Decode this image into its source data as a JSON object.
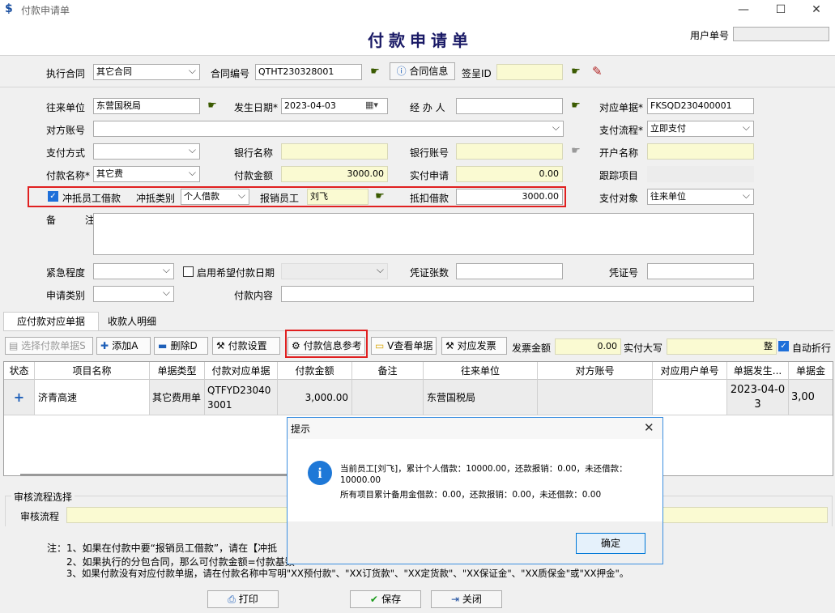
{
  "window": {
    "title": "付款申请单",
    "form_title": "付款申请单",
    "user_no_label": "用户单号",
    "user_no_value": ""
  },
  "row1": {
    "contract_label": "执行合同",
    "contract_value": "其它合同",
    "contract_no_label": "合同编号",
    "contract_no_value": "QTHT230328001",
    "contract_info_btn": "合同信息",
    "sign_id_label": "签呈ID",
    "sign_id_value": ""
  },
  "row2": {
    "unit_label": "往来单位",
    "unit_value": "东营国税局",
    "date_label": "发生日期*",
    "date_value": "2023-04-03",
    "handler_label": "经 办 人",
    "handler_value": "",
    "doc_label": "对应单据*",
    "doc_value": "FKSQD230400001"
  },
  "row3": {
    "account_label": "对方账号",
    "account_value": "",
    "flow_label": "支付流程*",
    "flow_value": "立即支付"
  },
  "row4": {
    "paymethod_label": "支付方式",
    "paymethod_value": "",
    "bankname_label": "银行名称",
    "bankname_value": "",
    "bankacct_label": "银行账号",
    "bankacct_value": "",
    "acctname_label": "开户名称",
    "acctname_value": ""
  },
  "row5": {
    "payname_label": "付款名称*",
    "payname_value": "其它费",
    "amount_label": "付款金额",
    "amount_value": "3000.00",
    "actual_label": "实付申请",
    "actual_value": "0.00",
    "track_label": "跟踪项目",
    "track_value": ""
  },
  "row6": {
    "offset_check_label": "冲抵员工借款",
    "offset_type_label": "冲抵类别",
    "offset_type_value": "个人借款",
    "employee_label": "报销员工",
    "employee_value": "刘飞",
    "deduct_label": "抵扣借款",
    "deduct_value": "3000.00",
    "target_label": "支付对象",
    "target_value": "往来单位"
  },
  "remark": {
    "label": "备　注",
    "value": ""
  },
  "row8": {
    "urgency_label": "紧急程度",
    "urgency_value": "",
    "hope_date_label": "启用希望付款日期",
    "voucher_count_label": "凭证张数",
    "voucher_count_value": "",
    "voucher_no_label": "凭证号",
    "voucher_no_value": ""
  },
  "row9": {
    "apply_type_label": "申请类别",
    "apply_type_value": "",
    "content_label": "付款内容",
    "content_value": ""
  },
  "tabs": [
    {
      "label": "应付款对应单据"
    },
    {
      "label": "收款人明细"
    }
  ],
  "toolbar": {
    "select_doc": "选择付款单据S",
    "add": "添加A",
    "delete": "删除D",
    "pay_settings": "付款设置",
    "pay_info_ref": "付款信息参考",
    "view_doc": "V查看单据",
    "invoice": "对应发票",
    "invoice_amt_label": "发票金额",
    "invoice_amt_value": "0.00",
    "actual_upper_label": "实付大写",
    "actual_upper_value": "整",
    "auto_discount": "自动折行"
  },
  "table": {
    "headers": [
      "状态",
      "项目名称",
      "单据类型",
      "付款对应单据",
      "付款金额",
      "备注",
      "往来单位",
      "对方账号",
      "对应用户单号",
      "单据发生...",
      "单据金"
    ],
    "rows": [
      {
        "status": "+",
        "project": "济青高速",
        "doc_type": "其它费用单",
        "pay_doc": "QTFYD230403001",
        "amount": "3,000.00",
        "remark": "",
        "unit": "东营国税局",
        "account": "",
        "user_no": "",
        "date": "2023-04-03",
        "doc_amount": "3,00"
      }
    ]
  },
  "approval": {
    "group_label": "审核流程选择",
    "flow_label": "审核流程",
    "flow_value": ""
  },
  "notes": {
    "line1": "注：1、如果在付款中要“报销员工借款”，请在【冲抵",
    "line2": "2、如果执行的分包合同，那么可付款金额=付款基数",
    "line3": "3、如果付款没有对应付款单据，请在付款名称中写明\"XX预付款\"、\"XX订货款\"、\"XX定货款\"、\"XX保证金\"、\"XX质保金\"或\"XX押金\"。"
  },
  "buttons": {
    "print": "打印",
    "save": "保存",
    "close": "关闭"
  },
  "dialog": {
    "title": "提示",
    "line1": "当前员工[刘飞]，累计个人借款：10000.00，还款报销：0.00，未还借款：",
    "line2": "10000.00",
    "line3": "所有项目累计备用金借款：0.00，还款报销：0.00，未还借款：0.00",
    "ok": "确定"
  }
}
